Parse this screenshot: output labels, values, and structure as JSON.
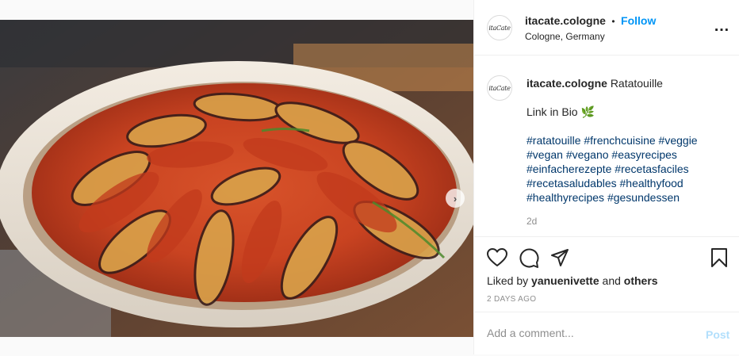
{
  "post": {
    "username": "itacate.cologne",
    "avatar_text": "itaCate",
    "follow_separator": "•",
    "follow_label": "Follow",
    "location": "Cologne, Germany",
    "more_icon": "…"
  },
  "media": {
    "next_icon": "›",
    "carousel_count": 4,
    "carousel_active": 1
  },
  "caption": {
    "username": "itacate.cologne",
    "title": "Ratatouille",
    "link_line": "Link in Bio 🌿",
    "hashtags": "#ratatouille #frenchcuisine #veggie #vegan #vegano #easyrecipes #einfacherezepte #recetasfaciles #recetasaludables #healthyfood #healthyrecipes #gesundessen",
    "time_ago": "2d"
  },
  "actions": {
    "liked_prefix": "Liked by",
    "liked_user": "yanuenivette",
    "liked_and": "and",
    "liked_others": "others",
    "date": "2 DAYS AGO"
  },
  "comment": {
    "placeholder": "Add a comment...",
    "post_label": "Post"
  },
  "colors": {
    "link_blue": "#0095f6",
    "hashtag_blue": "#00376b",
    "post_disabled": "#b2dffc"
  }
}
